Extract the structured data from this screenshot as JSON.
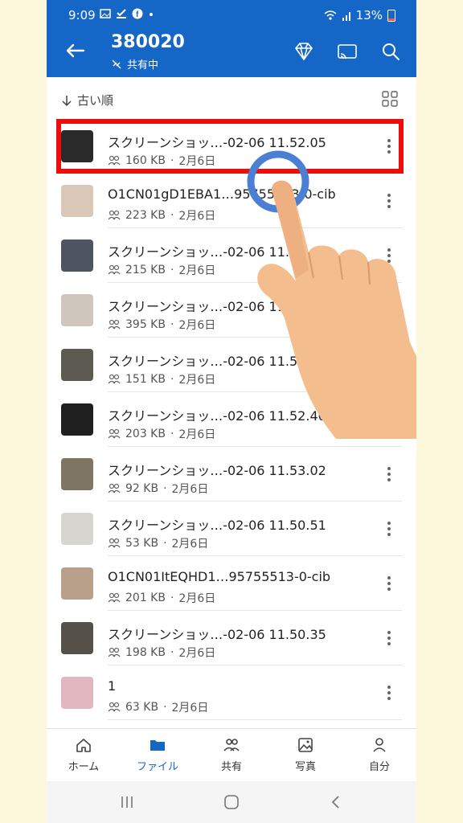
{
  "status": {
    "time": "9:09",
    "battery": "13%",
    "icons_left": [
      "gallery-icon",
      "check-download-icon",
      "facebook-icon",
      "dot-icon"
    ],
    "icons_right": [
      "wifi-icon",
      "signal-icon",
      "battery-icon"
    ]
  },
  "appbar": {
    "title": "380020",
    "subtitle": "共有中",
    "icons": [
      "back-arrow-icon",
      "premium-diamond-icon",
      "cast-icon",
      "search-icon"
    ]
  },
  "sort": {
    "label": "古い順"
  },
  "files": [
    {
      "name": "スクリーンショッ…-02-06 11.52.05",
      "size": "160 KB",
      "date": "2月6日",
      "thumb": "#2a2a2a"
    },
    {
      "name": "O1CN01gD1EBA1…95755513-0-cib",
      "size": "223 KB",
      "date": "2月6日",
      "thumb": "#d9c7b8"
    },
    {
      "name": "スクリーンショッ…-02-06 11.51.41",
      "size": "215 KB",
      "date": "2月6日",
      "thumb": "#4e5560"
    },
    {
      "name": "スクリーンショッ…-02-06 11.51.30",
      "size": "395 KB",
      "date": "2月6日",
      "thumb": "#cfc6bd"
    },
    {
      "name": "スクリーンショッ…-02-06 11.51.12",
      "size": "151 KB",
      "date": "2月6日",
      "thumb": "#5d5a52"
    },
    {
      "name": "スクリーンショッ…-02-06 11.52.40",
      "size": "203 KB",
      "date": "2月6日",
      "thumb": "#1f1f1f"
    },
    {
      "name": "スクリーンショッ…-02-06 11.53.02",
      "size": "92 KB",
      "date": "2月6日",
      "thumb": "#7f7563"
    },
    {
      "name": "スクリーンショッ…-02-06 11.50.51",
      "size": "53 KB",
      "date": "2月6日",
      "thumb": "#d8d6d0"
    },
    {
      "name": "O1CN01ItEQHD1…95755513-0-cib",
      "size": "201 KB",
      "date": "2月6日",
      "thumb": "#b9a08a"
    },
    {
      "name": "スクリーンショッ…-02-06 11.50.35",
      "size": "198 KB",
      "date": "2月6日",
      "thumb": "#55504a"
    },
    {
      "name": "1",
      "size": "63 KB",
      "date": "2月6日",
      "thumb": "#e2b7bf"
    }
  ],
  "nav": [
    {
      "label": "ホーム",
      "icon": "home-icon",
      "active": false
    },
    {
      "label": "ファイル",
      "icon": "folder-icon",
      "active": true
    },
    {
      "label": "共有",
      "icon": "people-icon",
      "active": false
    },
    {
      "label": "写真",
      "icon": "photo-icon",
      "active": false
    },
    {
      "label": "自分",
      "icon": "person-icon",
      "active": false
    }
  ],
  "colors": {
    "brand": "#1466c7",
    "highlight": "#ee0d0d",
    "background": "#fdf7dc"
  }
}
